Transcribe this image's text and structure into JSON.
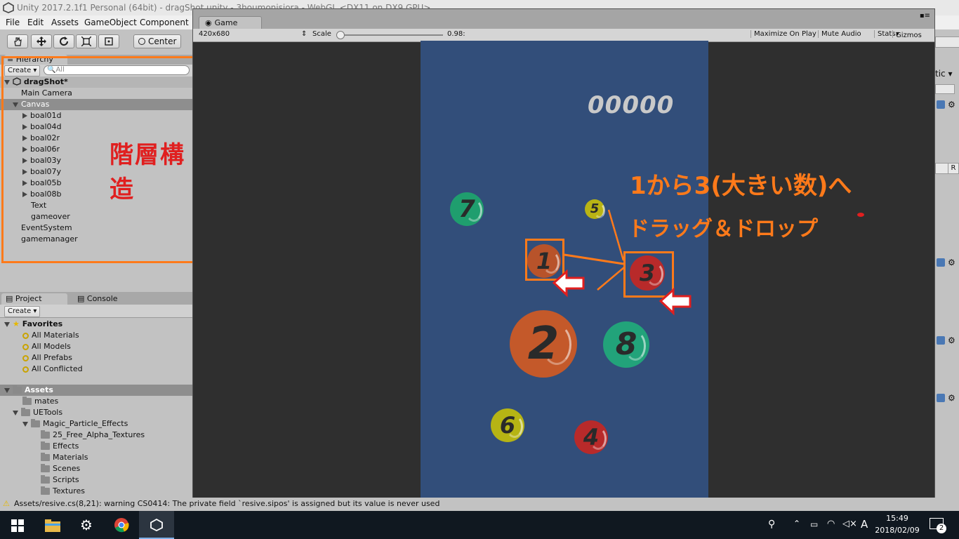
{
  "window": {
    "title": "Unity 2017.2.1f1 Personal (64bit) - dragShot.unity - 3houmonjsiora - WebGL <DX11 on DX9 GPU>"
  },
  "menu": [
    "File",
    "Edit",
    "Assets",
    "GameObject",
    "Component"
  ],
  "toolbar": {
    "pivot_label": "Center"
  },
  "hierarchy": {
    "tab_label": "Hierarchy",
    "create_label": "Create",
    "search_placeholder": "All",
    "scene_name": "dragShot*",
    "items": [
      {
        "label": "Main Camera"
      },
      {
        "label": "Canvas"
      },
      {
        "label": "boal01d"
      },
      {
        "label": "boal04d"
      },
      {
        "label": "boal02r"
      },
      {
        "label": "boal06r"
      },
      {
        "label": "boal03y"
      },
      {
        "label": "boal07y"
      },
      {
        "label": "boal05b"
      },
      {
        "label": "boal08b"
      },
      {
        "label": "Text"
      },
      {
        "label": "gameover"
      },
      {
        "label": "EventSystem"
      },
      {
        "label": "gamemanager"
      }
    ]
  },
  "project": {
    "tab_project": "Project",
    "tab_console": "Console",
    "create_label": "Create",
    "favorites_label": "Favorites",
    "favorites": [
      "All Materials",
      "All Models",
      "All Prefabs",
      "All Conflicted"
    ],
    "assets_label": "Assets",
    "folders": [
      "mates",
      "UETools",
      "Magic_Particle_Effects",
      "25_Free_Alpha_Textures",
      "Effects",
      "Materials",
      "Scenes",
      "Scripts",
      "Textures"
    ]
  },
  "game": {
    "tab_label": "Game",
    "resolution": "420x680",
    "scale_label": "Scale",
    "scale_value": "0.98:",
    "buttons": [
      "Maximize On Play",
      "Mute Audio",
      "Stats",
      "Gizmos"
    ],
    "score": "00000",
    "balls": [
      {
        "label": "7",
        "color": "#1f9e6e"
      },
      {
        "label": "5",
        "color": "#b9b414"
      },
      {
        "label": "1",
        "color": "#b8532a"
      },
      {
        "label": "3",
        "color": "#b82a2a"
      },
      {
        "label": "2",
        "color": "#c4592a"
      },
      {
        "label": "8",
        "color": "#22a37a"
      },
      {
        "label": "6",
        "color": "#b6b414"
      },
      {
        "label": "4",
        "color": "#b82a2a"
      }
    ]
  },
  "annotations": {
    "hierarchy_note": "階層構造",
    "instruction_line1": "1から3(大きい数)へ",
    "instruction_line2": "ドラッグ＆ドロップ"
  },
  "inspector": {
    "partial_label": "tic",
    "r_button": "R"
  },
  "status": {
    "message": "Assets/resive.cs(8,21): warning CS0414: The private field `resive.sipos' is assigned but its value is never used"
  },
  "taskbar": {
    "time": "15:49",
    "date": "2018/02/09",
    "ime": "A",
    "notifications": "2"
  },
  "colors": {
    "accent_orange": "#ff7a1a",
    "annotation_red": "#e01f1f",
    "play_bg": "#324e7a"
  }
}
